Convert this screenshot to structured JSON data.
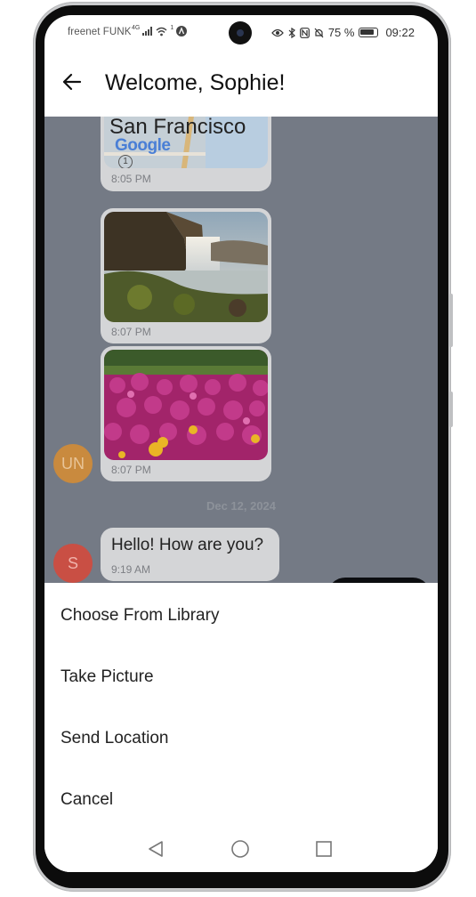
{
  "status_bar": {
    "carrier": "freenet FUNK",
    "network": "4G",
    "sim": "1",
    "battery": "75 %",
    "battery_level": 0.75,
    "time": "09:22"
  },
  "header": {
    "title": "Welcome, Sophie!",
    "back_icon": "arrow-left-icon"
  },
  "chat": {
    "messages": [
      {
        "type": "location",
        "map_title": "San Francisco",
        "map_brand": "Google",
        "map_marker": "1",
        "time": "8:05 PM"
      },
      {
        "type": "image",
        "subject": "waterfall",
        "time": "8:07 PM"
      },
      {
        "type": "image",
        "subject": "flowers",
        "time": "8:07 PM"
      },
      {
        "type": "text",
        "text": "Hello! How are you?",
        "time": "9:19 AM"
      }
    ],
    "avatars": [
      {
        "initials": "UN",
        "color": "#c98a3e"
      },
      {
        "initials": "S",
        "color": "#c94f44"
      }
    ],
    "date_separator": "Dec 12, 2024"
  },
  "action_sheet": {
    "items": [
      "Choose From Library",
      "Take Picture",
      "Send Location",
      "Cancel"
    ]
  },
  "navigation": {
    "back_icon": "triangle-back-icon",
    "home_icon": "circle-home-icon",
    "recents_icon": "square-recents-icon"
  }
}
